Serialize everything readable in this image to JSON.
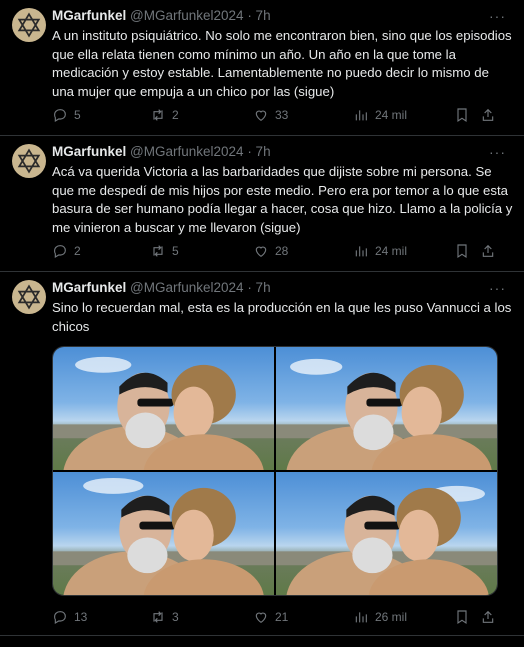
{
  "tweets": [
    {
      "name": "MGarfunkel",
      "handle": "@MGarfunkel2024",
      "time": "· 7h",
      "text": "A un instituto psiquiátrico. No solo me encontraron bien, sino que los episodios que ella relata tienen como mínimo un año. Un año en la que tome la medicación y estoy estable. Lamentablemente no puedo decir lo mismo de una mujer que empuja a un chico por las (sigue)",
      "replies": "5",
      "reposts": "2",
      "likes": "33",
      "views": "24 mil"
    },
    {
      "name": "MGarfunkel",
      "handle": "@MGarfunkel2024",
      "time": "· 7h",
      "text": "Acá va querida Victoria a las barbaridades que dijiste sobre mi persona. Se que me despedí de mis hijos por este medio. Pero era por temor a lo que esta basura de ser humano podía llegar a hacer, cosa que hizo. Llamo a la policía y me vinieron a buscar y me llevaron (sigue)",
      "replies": "2",
      "reposts": "5",
      "likes": "28",
      "views": "24 mil"
    },
    {
      "name": "MGarfunkel",
      "handle": "@MGarfunkel2024",
      "time": "· 7h",
      "text": "Sino lo recuerdan mal, esta es la producción en la que les puso Vannucci a los chicos",
      "replies": "13",
      "reposts": "3",
      "likes": "21",
      "views": "26 mil"
    }
  ],
  "more_glyph": "···",
  "colors": {
    "background": "#000000",
    "text": "#e7e9ea",
    "muted": "#71767b",
    "border": "#2f3336",
    "avatar": "#c9b68f"
  },
  "icons": [
    "star-of-david-icon",
    "reply-icon",
    "repost-icon",
    "like-icon",
    "views-icon",
    "bookmark-icon",
    "share-icon"
  ]
}
